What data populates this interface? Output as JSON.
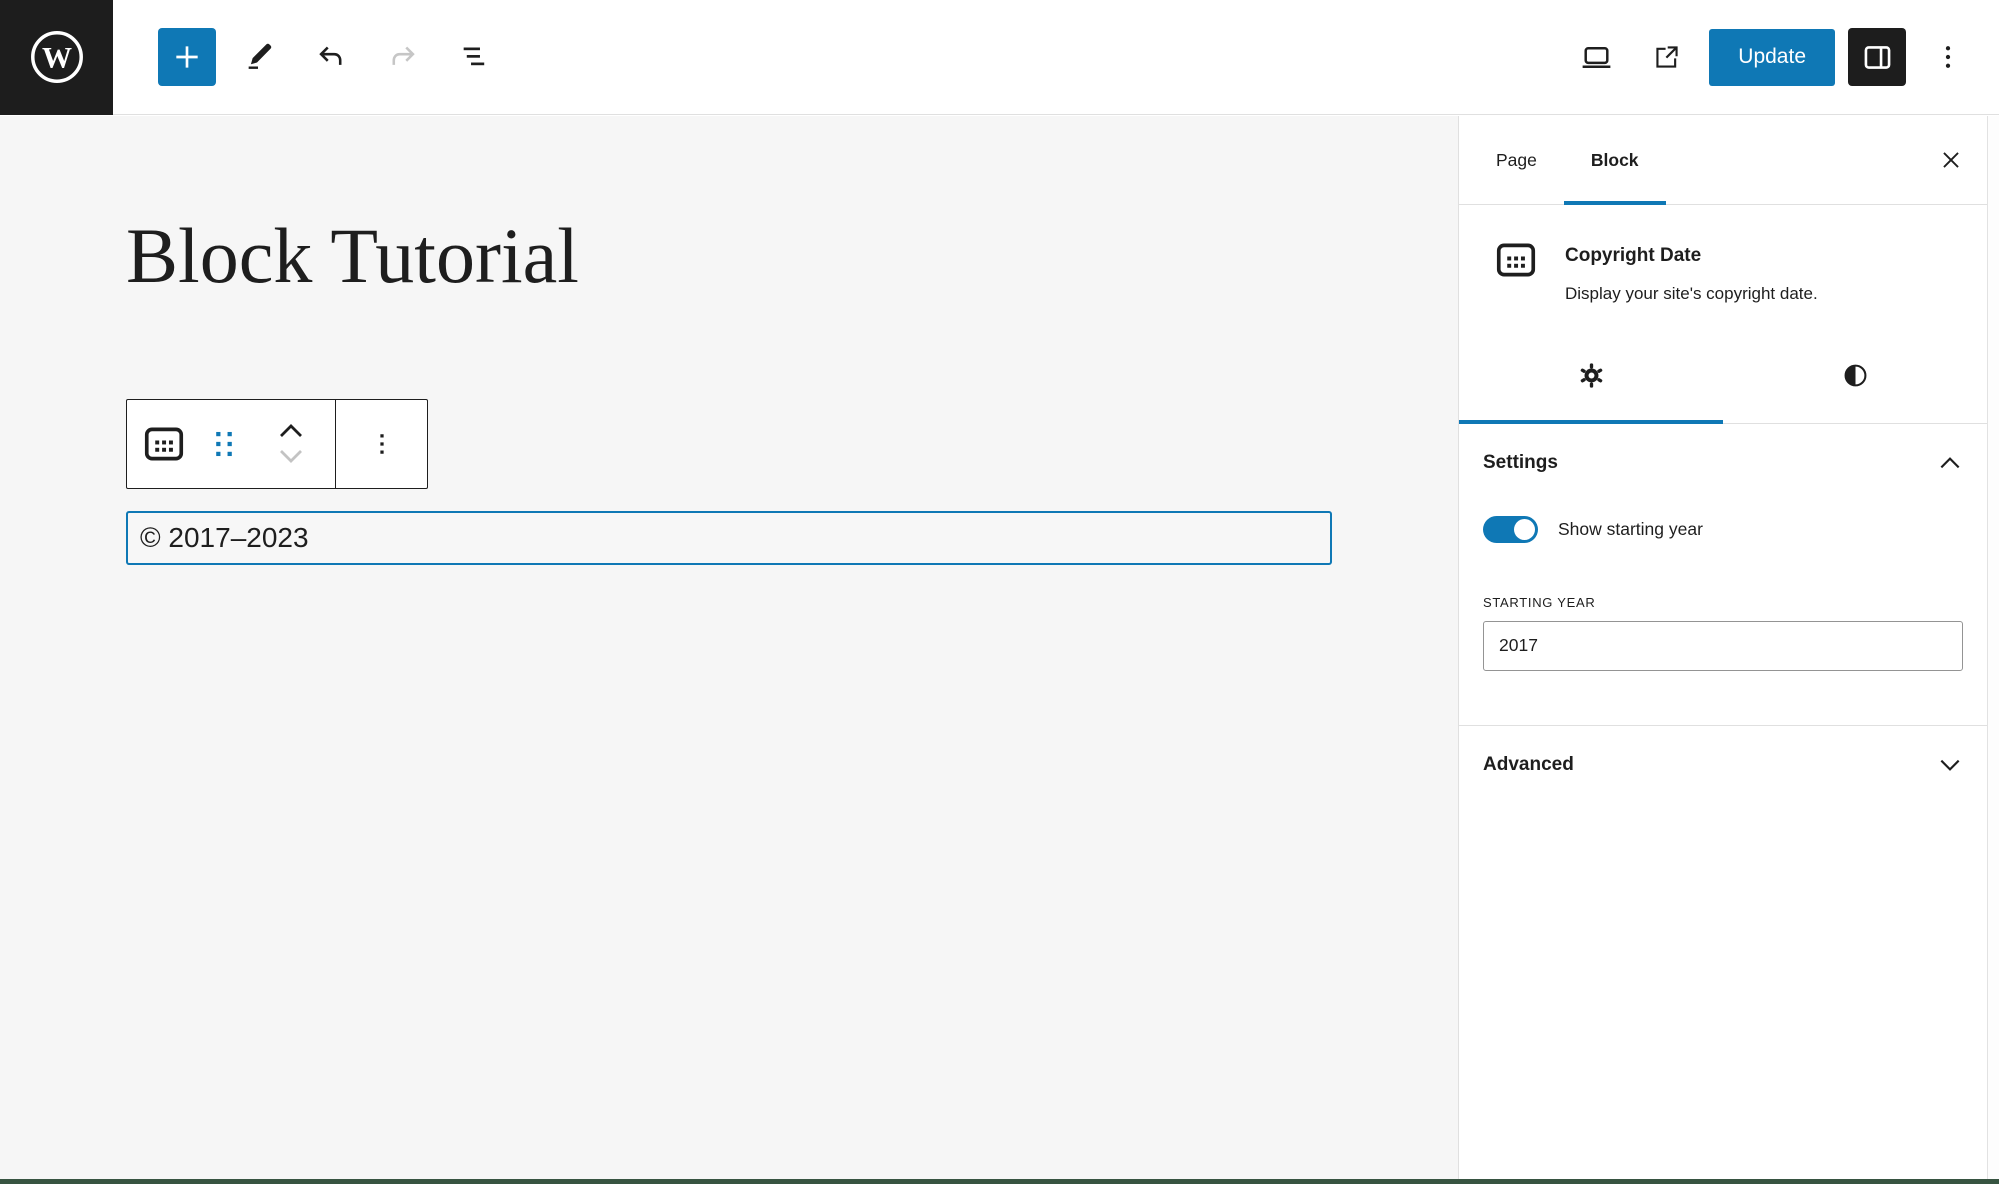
{
  "colors": {
    "accent": "#0f78b5",
    "topbar_bg": "#ffffff",
    "canvas_bg": "#f6f6f6",
    "sidebar_bg": "#ffffff",
    "text": "#1e1e1e",
    "border": "#e0e0e0",
    "bottom_bar": "#375441"
  },
  "topbar": {
    "update_label": "Update"
  },
  "canvas": {
    "page_title": "Block Tutorial",
    "copyright_text": "© 2017–2023"
  },
  "sidebar": {
    "tabs": [
      {
        "label": "Page",
        "active": false
      },
      {
        "label": "Block",
        "active": true
      }
    ],
    "block_card": {
      "title": "Copyright Date",
      "description": "Display your site's copyright date."
    },
    "settings_panel": {
      "title": "Settings",
      "show_starting_year_label": "Show starting year",
      "starting_year_label": "STARTING YEAR",
      "starting_year_value": "2017"
    },
    "advanced": {
      "label": "Advanced"
    }
  }
}
